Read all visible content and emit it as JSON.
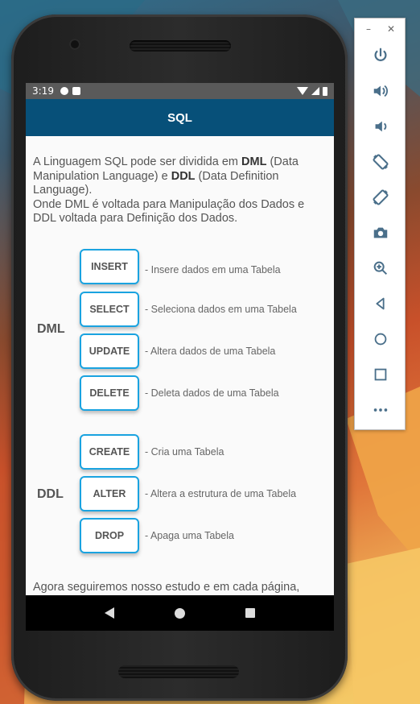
{
  "status_bar": {
    "time": "3:19"
  },
  "app_bar": {
    "title": "SQL"
  },
  "intro": {
    "l1_a": "A Linguagem SQL pode ser dividida em ",
    "l1_b": "DML",
    "l1_c": " (Data",
    "l2_a": "Manipulation Language) e ",
    "l2_b": "DDL",
    "l2_c": " (Data Definition",
    "l3": "Language).",
    "l4": "Onde DML é voltada para Manipulação dos Dados e",
    "l5": "DDL voltada para Definição dos Dados."
  },
  "dml": {
    "label": "DML",
    "commands": [
      {
        "label": "INSERT",
        "desc": "- Insere dados em uma Tabela"
      },
      {
        "label": "SELECT",
        "desc": "- Seleciona dados em uma Tabela"
      },
      {
        "label": "UPDATE",
        "desc": "- Altera dados de uma Tabela"
      },
      {
        "label": "DELETE",
        "desc": "- Deleta dados de uma Tabela"
      }
    ]
  },
  "ddl": {
    "label": "DDL",
    "commands": [
      {
        "label": "CREATE",
        "desc": "- Cria uma Tabela"
      },
      {
        "label": "ALTER",
        "desc": "- Altera a estrutura de uma Tabela"
      },
      {
        "label": "DROP",
        "desc": "- Apaga uma Tabela"
      }
    ]
  },
  "outro": "Agora seguiremos nosso estudo e em cada página,",
  "emulator_toolbar": {
    "minimize": "–",
    "close": "✕",
    "buttons": [
      "power-icon",
      "volume-up-icon",
      "volume-down-icon",
      "rotate-left-icon",
      "rotate-right-icon",
      "camera-icon",
      "zoom-icon",
      "back-icon",
      "home-icon",
      "overview-icon",
      "more-icon"
    ]
  },
  "colors": {
    "app_bar": "#075079",
    "button_border": "#1aa3e0",
    "toolbar_icon": "#4a6f8a"
  }
}
